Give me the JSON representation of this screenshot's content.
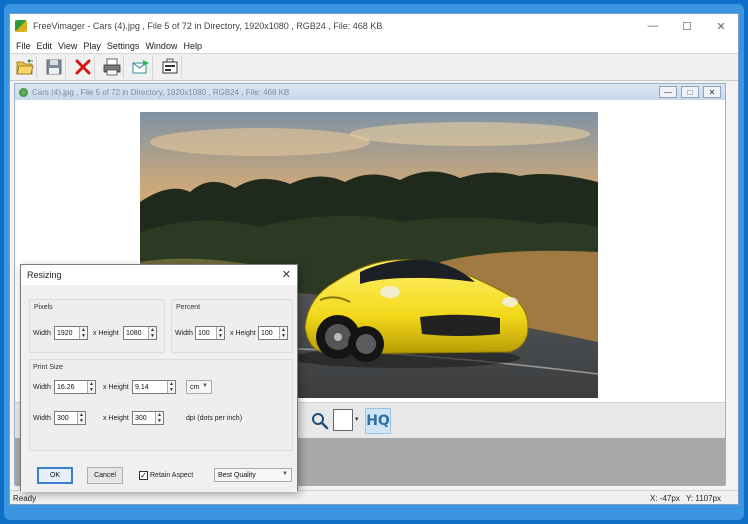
{
  "app": {
    "title": "FreeVimager - Cars (4).jpg , File 5 of 72 in Directory, 1920x1080 , RGB24 , File: 468 KB",
    "window_controls": [
      "—",
      "☐",
      "✕"
    ]
  },
  "menu": [
    "File",
    "Edit",
    "View",
    "Play",
    "Settings",
    "Window",
    "Help"
  ],
  "toolbar": [
    {
      "name": "open-folder-icon",
      "color": "#2f8a2a"
    },
    {
      "name": "save-disk-icon",
      "color": "#5a6a7a"
    },
    {
      "name": "delete-x-icon",
      "color": "#d01818"
    },
    {
      "name": "print-icon",
      "color": "#444444"
    },
    {
      "name": "email-send-icon",
      "color": "#1e9bb0"
    },
    {
      "name": "slideshow-icon",
      "color": "#333333"
    }
  ],
  "child_window": {
    "title": "Cars (4).jpg , File 5 of 72 in Directory, 1920x1080 , RGB24 , File: 468 KB",
    "controls": [
      "—",
      "□",
      "✕"
    ]
  },
  "bottom_toolbar": {
    "hq_label": "HQ"
  },
  "status": {
    "left": "Ready",
    "x": "X: -47px",
    "y": "Y: 1107px"
  },
  "dialog": {
    "title": "Resizing",
    "close": "✕",
    "pixels": {
      "label": "Pixels",
      "width_label": "Width",
      "width_value": "1920",
      "height_label": "x Height",
      "height_value": "1080"
    },
    "percent": {
      "label": "Percent",
      "width_label": "Width",
      "width_value": "100",
      "height_label": "x Height",
      "height_value": "100"
    },
    "print_size": {
      "label": "Print Size",
      "width_label": "Width",
      "width_value": "16.26",
      "height_label": "x Height",
      "height_value": "9.14",
      "unit": "cm",
      "dpi_width_label": "Width",
      "dpi_width_value": "300",
      "dpi_height_label": "x Height",
      "dpi_height_value": "300",
      "dpi_label": "dpi (dots per inch)"
    },
    "ok": "OK",
    "cancel": "Cancel",
    "retain_aspect": {
      "label": "Retain Aspect",
      "checked": true
    },
    "quality": "Best Quality"
  }
}
